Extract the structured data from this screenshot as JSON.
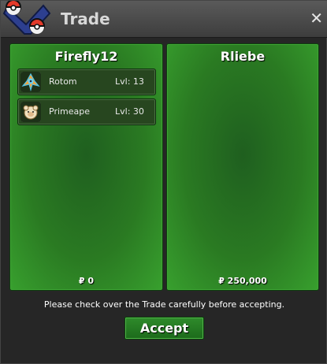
{
  "window": {
    "title": "Trade",
    "close_icon": "close-icon",
    "logo_icon": "pokeball-logo-icon"
  },
  "left_panel": {
    "trainer": "Firefly12",
    "pokemon": [
      {
        "name": "Rotom",
        "level": "Lvl: 13",
        "icon": "rotom-icon"
      },
      {
        "name": "Primeape",
        "level": "Lvl: 30",
        "icon": "primeape-icon"
      }
    ],
    "money": "₽ 0"
  },
  "right_panel": {
    "trainer": "Rliebe",
    "pokemon": [],
    "money": "₽ 250,000"
  },
  "notice": "Please check over the Trade carefully before accepting.",
  "accept_label": "Accept",
  "colors": {
    "panel_green": "#2a7a22",
    "button_green": "#1c6a1b",
    "titlebar_gray": "#4a4a4a"
  }
}
